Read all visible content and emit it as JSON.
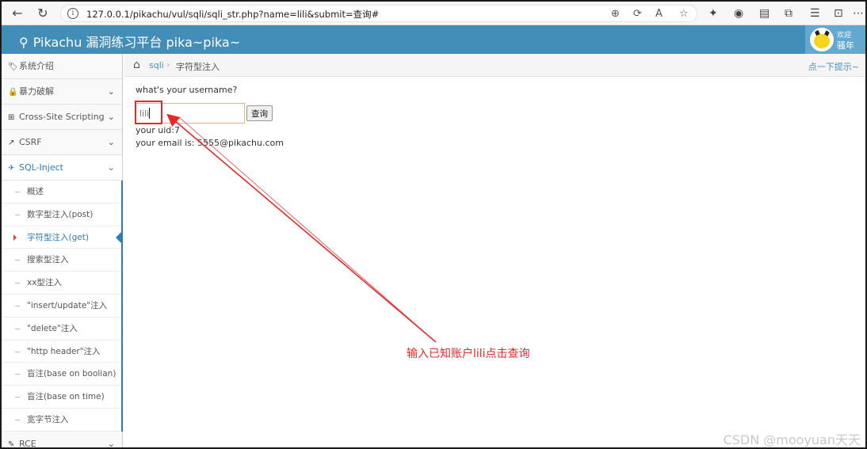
{
  "browser": {
    "url": "127.0.0.1/pikachu/vul/sqli/sqli_str.php?name=lili&submit=查询#"
  },
  "header": {
    "title": "Pikachu 漏洞练习平台 pika~pika~",
    "user_line1": "欢迎",
    "user_line2": "骚年"
  },
  "sidebar": {
    "items": [
      {
        "label": "系统介绍",
        "icon": "tags-icon"
      },
      {
        "label": "暴力破解",
        "icon": "lock-icon"
      },
      {
        "label": "Cross-Site Scripting",
        "icon": "sitemap-icon"
      },
      {
        "label": "CSRF",
        "icon": "share-icon"
      },
      {
        "label": "SQL-Inject",
        "icon": "plane-icon"
      }
    ],
    "sub_items": [
      "概述",
      "数字型注入(post)",
      "字符型注入(get)",
      "搜索型注入",
      "xx型注入",
      "\"insert/update\"注入",
      "\"delete\"注入",
      "\"http header\"注入",
      "盲注(base on boolian)",
      "盲注(base on time)",
      "宽字节注入"
    ],
    "bottom_item": {
      "label": "RCE",
      "icon": "pencil-icon"
    }
  },
  "breadcrumb": {
    "section": "sqli",
    "page": "字符型注入",
    "hint": "点一下提示~"
  },
  "main": {
    "prompt": "what's your username?",
    "input_value": "lili",
    "submit_label": "查询",
    "result_uid": "your uid:7",
    "result_email": "your email is: 5555@pikachu.com"
  },
  "annotation": {
    "text": "输入已知账户lili点击查询",
    "color": "#e8282a"
  },
  "watermark": "CSDN @mooyuan天天",
  "colors": {
    "header": "#438eb9",
    "active": "#2b7dbc"
  }
}
